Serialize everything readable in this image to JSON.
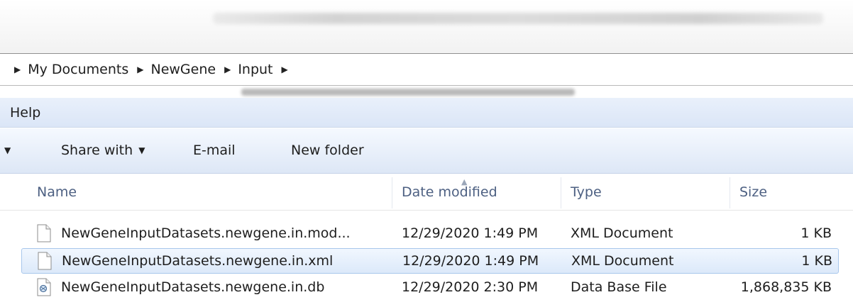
{
  "address_bar": {
    "crumbs": [
      "My Documents",
      "NewGene",
      "Input"
    ]
  },
  "menu": {
    "help": "Help"
  },
  "toolbar": {
    "share_with": "Share with",
    "email": "E-mail",
    "new_folder": "New folder"
  },
  "columns": {
    "name": "Name",
    "date_modified": "Date modified",
    "type": "Type",
    "size": "Size"
  },
  "files": [
    {
      "name": "NewGeneInputDatasets.newgene.in.mod...",
      "date": "12/29/2020 1:49 PM",
      "type": "XML Document",
      "size": "1 KB",
      "icon": "document-icon",
      "selected": false
    },
    {
      "name": "NewGeneInputDatasets.newgene.in.xml",
      "date": "12/29/2020 1:49 PM",
      "type": "XML Document",
      "size": "1 KB",
      "icon": "document-icon",
      "selected": true
    },
    {
      "name": "NewGeneInputDatasets.newgene.in.db",
      "date": "12/29/2020 2:30 PM",
      "type": "Data Base File",
      "size": "1,868,835 KB",
      "icon": "database-file-icon",
      "selected": false
    }
  ],
  "colors": {
    "menu_bar": "#dbe6f7",
    "toolbar": "#dde7f6",
    "header_text": "#4d6082",
    "selection_border": "#a8c7ec"
  }
}
